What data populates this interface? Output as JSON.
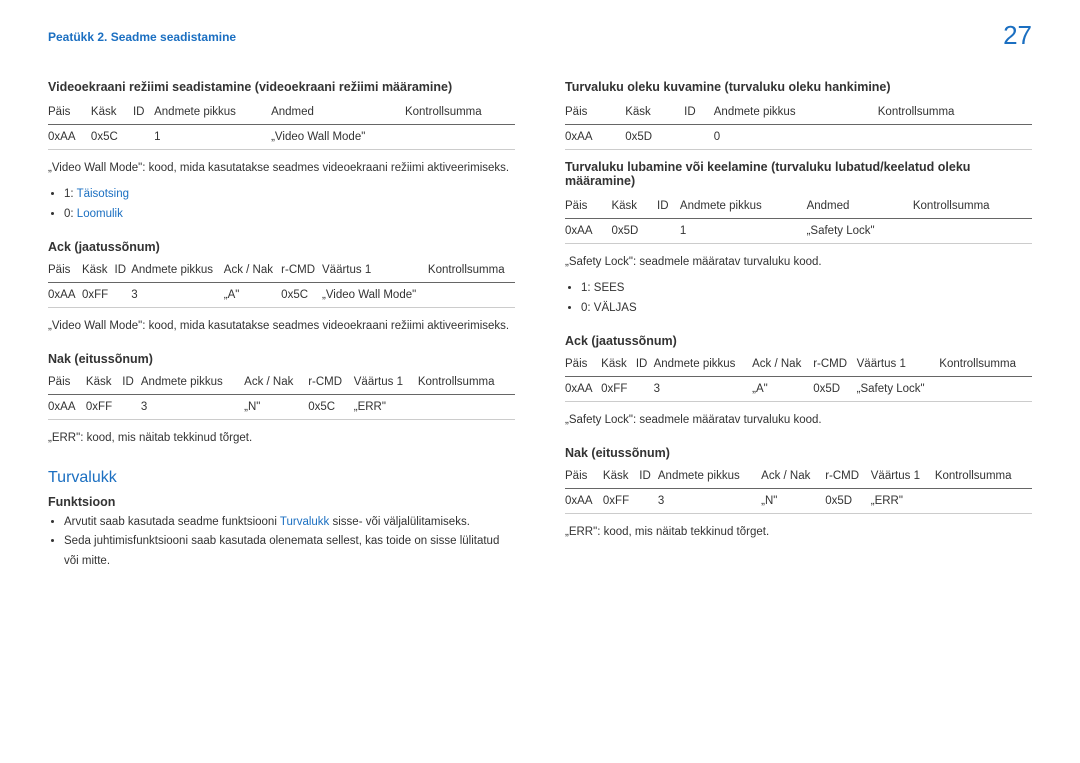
{
  "header": {
    "chapter": "Peatükk 2. Seadme seadistamine",
    "page": "27"
  },
  "left": {
    "title": "Videoekraani režiimi seadistamine (videoekraani režiimi määramine)",
    "t1": {
      "h": [
        "Päis",
        "Käsk",
        "ID",
        "Andmete pikkus",
        "Andmed",
        "Kontrollsumma"
      ],
      "r": [
        "0xAA",
        "0x5C",
        "",
        "1",
        "„Video Wall Mode\"",
        ""
      ]
    },
    "n1": "„Video Wall Mode\": kood, mida kasutatakse seadmes videoekraani režiimi aktiveerimiseks.",
    "b1a_prefix": "1: ",
    "b1a_link": "Täisotsing",
    "b1b_prefix": "0: ",
    "b1b_link": "Loomulik",
    "ack_h": "Ack (jaatussõnum)",
    "t2": {
      "h": [
        "Päis",
        "Käsk",
        "ID",
        "Andmete pikkus",
        "Ack / Nak",
        "r-CMD",
        "Väärtus 1",
        "Kontrollsumma"
      ],
      "r": [
        "0xAA",
        "0xFF",
        "",
        "3",
        "„A\"",
        "0x5C",
        "„Video Wall Mode\"",
        ""
      ]
    },
    "n2": "„Video Wall Mode\": kood, mida kasutatakse seadmes videoekraani režiimi aktiveerimiseks.",
    "nak_h": "Nak (eitussõnum)",
    "t3": {
      "h": [
        "Päis",
        "Käsk",
        "ID",
        "Andmete pikkus",
        "Ack / Nak",
        "r-CMD",
        "Väärtus 1",
        "Kontrollsumma"
      ],
      "r": [
        "0xAA",
        "0xFF",
        "",
        "3",
        "„N\"",
        "0x5C",
        "„ERR\"",
        ""
      ]
    },
    "n3": "„ERR\": kood, mis näitab tekkinud tõrget.",
    "blue": "Turvalukk",
    "func_h": "Funktsioon",
    "func1_pre": "Arvutit saab kasutada seadme funktsiooni ",
    "func1_link": "Turvalukk",
    "func1_post": " sisse- või väljalülitamiseks.",
    "func2": "Seda juhtimisfunktsiooni saab kasutada olenemata sellest, kas toide on sisse lülitatud või mitte."
  },
  "right": {
    "title1": "Turvaluku oleku kuvamine (turvaluku oleku hankimine)",
    "t1": {
      "h": [
        "Päis",
        "Käsk",
        "ID",
        "Andmete pikkus",
        "Kontrollsumma"
      ],
      "r": [
        "0xAA",
        "0x5D",
        "",
        "0",
        ""
      ]
    },
    "title2": "Turvaluku lubamine või keelamine (turvaluku lubatud/keelatud oleku määramine)",
    "t2": {
      "h": [
        "Päis",
        "Käsk",
        "ID",
        "Andmete pikkus",
        "Andmed",
        "Kontrollsumma"
      ],
      "r": [
        "0xAA",
        "0x5D",
        "",
        "1",
        "„Safety Lock\"",
        ""
      ]
    },
    "n1": "„Safety Lock\": seadmele määratav turvaluku kood.",
    "b1": "1: SEES",
    "b2": "0: VÄLJAS",
    "ack_h": "Ack (jaatussõnum)",
    "t3": {
      "h": [
        "Päis",
        "Käsk",
        "ID",
        "Andmete pikkus",
        "Ack / Nak",
        "r-CMD",
        "Väärtus 1",
        "Kontrollsumma"
      ],
      "r": [
        "0xAA",
        "0xFF",
        "",
        "3",
        "„A\"",
        "0x5D",
        "„Safety Lock\"",
        ""
      ]
    },
    "n2": "„Safety Lock\": seadmele määratav turvaluku kood.",
    "nak_h": "Nak (eitussõnum)",
    "t4": {
      "h": [
        "Päis",
        "Käsk",
        "ID",
        "Andmete pikkus",
        "Ack / Nak",
        "r-CMD",
        "Väärtus 1",
        "Kontrollsumma"
      ],
      "r": [
        "0xAA",
        "0xFF",
        "",
        "3",
        "„N\"",
        "0x5D",
        "„ERR\"",
        ""
      ]
    },
    "n3": "„ERR\": kood, mis näitab tekkinud tõrget."
  }
}
